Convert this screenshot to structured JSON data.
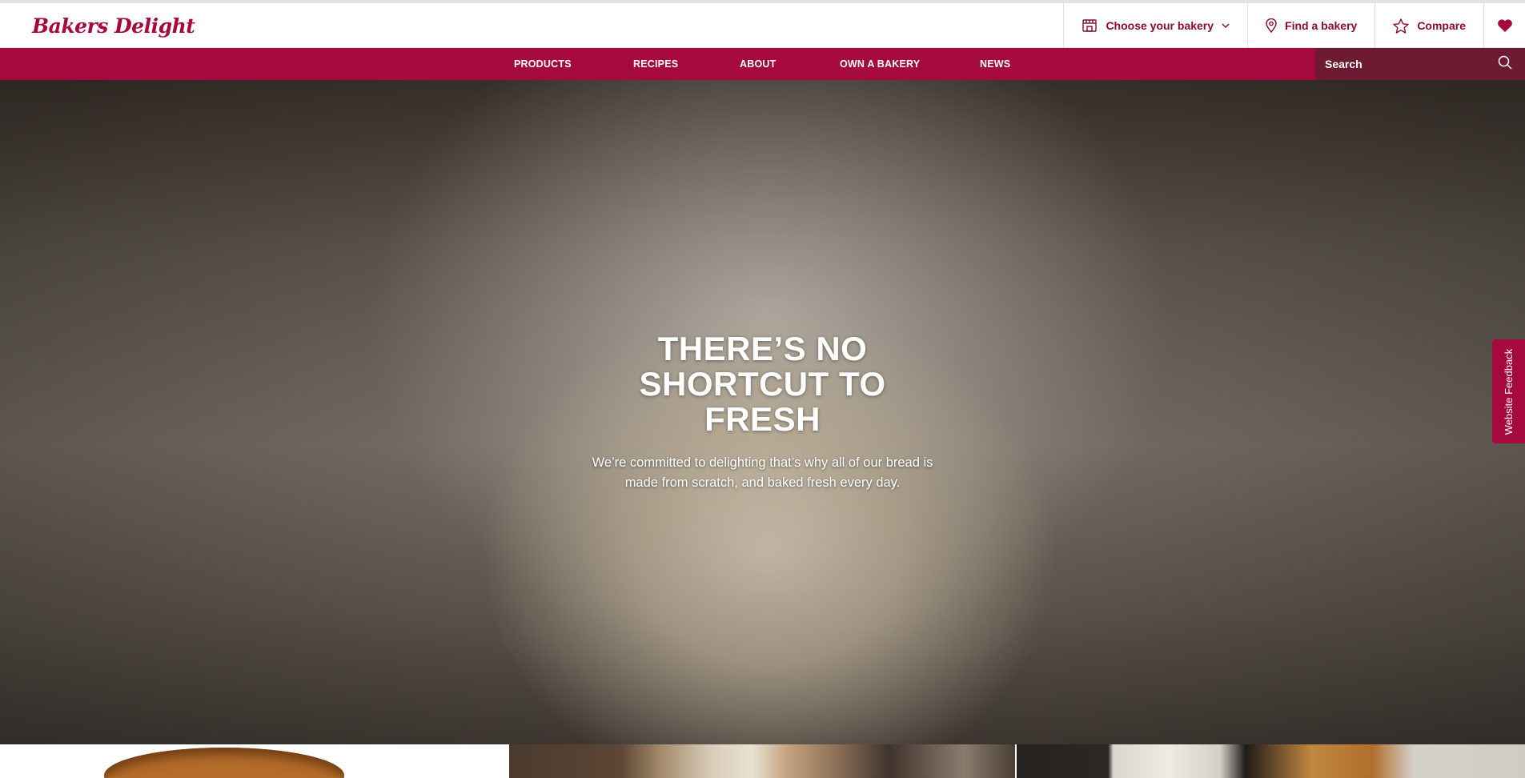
{
  "header": {
    "logo_text": "Bakers Delight",
    "choose_bakery_label": "Choose your bakery",
    "find_bakery_label": "Find a bakery",
    "compare_label": "Compare"
  },
  "nav": {
    "items": [
      "PRODUCTS",
      "RECIPES",
      "ABOUT",
      "OWN A BAKERY",
      "NEWS"
    ],
    "search_placeholder": "Search"
  },
  "hero": {
    "title": "THERE’S NO SHORTCUT TO FRESH",
    "subtitle": "We’re committed to delighting that’s why all of our bread is made from scratch, and baked fresh every day."
  },
  "feedback": {
    "label": "Website Feedback"
  },
  "colors": {
    "brand": "#a6093d",
    "search_bg": "#6e1a33",
    "text_on_brand": "#ffffff"
  },
  "icons": [
    "store-icon",
    "chevron-down-icon",
    "location-pin-icon",
    "star-icon",
    "heart-icon",
    "search-icon"
  ]
}
